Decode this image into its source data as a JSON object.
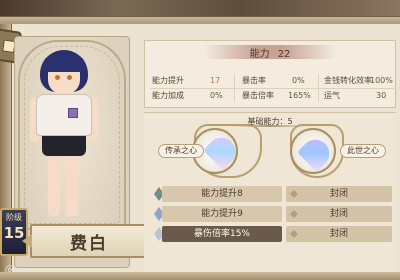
{
  "character": {
    "name": "费白",
    "level_label": "阶级",
    "level": "15"
  },
  "stats": {
    "title": "能力",
    "total": "22",
    "rows": [
      [
        {
          "label": "能力提升",
          "value": "17"
        },
        {
          "label": "暴击率",
          "value": "0%"
        },
        {
          "label": "金钱转化效率",
          "value": "100%"
        }
      ],
      [
        {
          "label": "能力加成",
          "value": "0%"
        },
        {
          "label": "暴击倍率",
          "value": "165%"
        },
        {
          "label": "运气",
          "value": "30"
        }
      ]
    ]
  },
  "base_ability": {
    "label": "基础能力：5",
    "left_heart": "传承之心",
    "right_heart": "此世之心"
  },
  "skills": [
    {
      "name": "能力提升8",
      "slot": "封闭"
    },
    {
      "name": "能力提升9",
      "slot": "封闭"
    },
    {
      "name": "暴伤倍率15%",
      "slot": "封闭"
    }
  ],
  "icons": {
    "corner": "cube-icon",
    "ring": "ring-icon",
    "gems": [
      "green-gem-icon",
      "blue-gem-icon",
      "silver-gem-icon"
    ]
  },
  "colors": {
    "accent_value": "#c0784a",
    "panel": "#ece3d3",
    "name_text": "#4b3b2c"
  }
}
